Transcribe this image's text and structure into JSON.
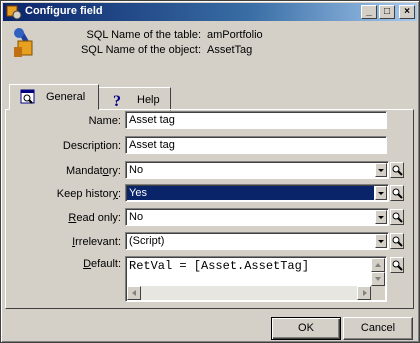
{
  "window": {
    "title": "Configure field"
  },
  "info": {
    "table_label": "SQL Name of the table:",
    "table_value": "amPortfolio",
    "object_label": "SQL Name of the object:",
    "object_value": "AssetTag"
  },
  "tabs": [
    {
      "label": "General",
      "icon": "magnifier-window-icon",
      "active": true
    },
    {
      "label": "Help",
      "icon": "question-mark-icon",
      "active": false
    }
  ],
  "fields": {
    "name": {
      "label": "Name:",
      "value": "Asset tag"
    },
    "description": {
      "label": "Description:",
      "value": "Asset tag"
    },
    "mandatory": {
      "label_pre": "Mandat",
      "label_u": "o",
      "label_post": "ry:",
      "value": "No"
    },
    "keep_history": {
      "label_pre": "Keep histor",
      "label_u": "y",
      "label_post": ":",
      "value": "Yes",
      "selected": true
    },
    "read_only": {
      "label_pre": "",
      "label_u": "R",
      "label_post": "ead only:",
      "value": "No"
    },
    "irrelevant": {
      "label_pre": "",
      "label_u": "I",
      "label_post": "rrelevant:",
      "value": "(Script)"
    },
    "default": {
      "label_pre": "",
      "label_u": "D",
      "label_post": "efault:",
      "value": "RetVal = [Asset.AssetTag]"
    }
  },
  "buttons": {
    "ok": "OK",
    "cancel": "Cancel"
  },
  "colors": {
    "titlebar_start": "#0a246a",
    "titlebar_end": "#a6caf0",
    "selection": "#0a246a"
  }
}
